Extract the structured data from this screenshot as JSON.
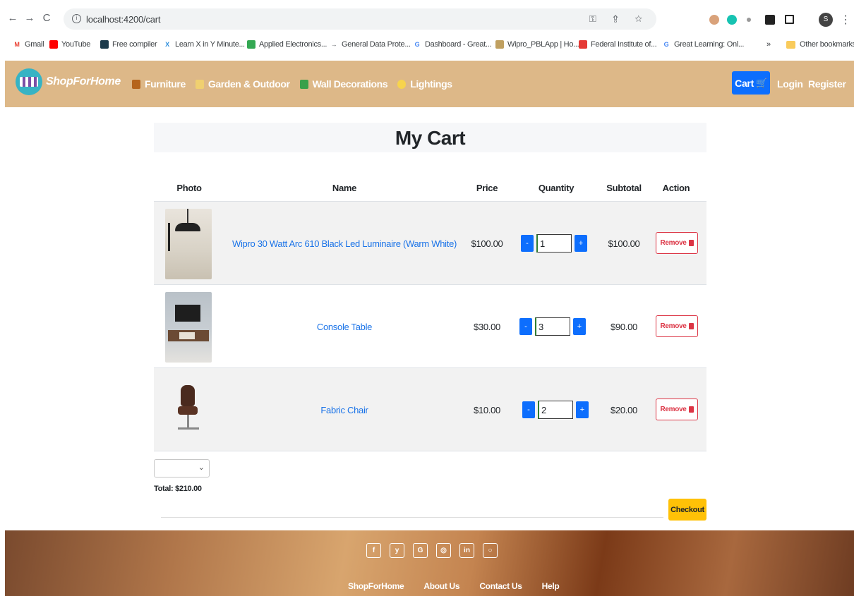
{
  "browser": {
    "url": "localhost:4200/cart",
    "bookmarks": [
      {
        "label": "Gmail",
        "icon": "gmail-icon",
        "color": "#ea4335"
      },
      {
        "label": "YouTube",
        "icon": "youtube-icon",
        "color": "#ff0000"
      },
      {
        "label": "Free compiler",
        "icon": "compiler-icon",
        "color": "#1b3a4b"
      },
      {
        "label": "Learn X in Y Minute...",
        "icon": "x-icon",
        "color": "#2f8fdd"
      },
      {
        "label": "Applied Electronics...",
        "icon": "drive-icon",
        "color": "#34a853"
      },
      {
        "label": "General Data Prote...",
        "icon": "arrow-icon",
        "color": "#5f6368"
      },
      {
        "label": "Dashboard - Great...",
        "icon": "g-icon",
        "color": "#4285f4"
      },
      {
        "label": "Wipro_PBLApp | Ho...",
        "icon": "wipro-icon",
        "color": "#c0a060"
      },
      {
        "label": "Federal Institute of...",
        "icon": "fi-icon",
        "color": "#e53935"
      },
      {
        "label": "Great Learning: Onl...",
        "icon": "g-icon",
        "color": "#4285f4"
      }
    ],
    "more": "»",
    "other_bookmarks": "Other bookmarks",
    "profile_initial": "S"
  },
  "navbar": {
    "brand": "ShopForHome",
    "menu": [
      {
        "label": "Furniture",
        "icon": "chair-icon",
        "color": "#b5651d"
      },
      {
        "label": "Garden & Outdoor",
        "icon": "flower-icon",
        "color": "#f0d070"
      },
      {
        "label": "Wall Decorations",
        "icon": "picture-icon",
        "color": "#3aa04a"
      },
      {
        "label": "Lightings",
        "icon": "bulb-icon",
        "color": "#f7d44c"
      }
    ],
    "cart_label": "Cart",
    "login": "Login",
    "register": "Register",
    "accent": "#0d6efd"
  },
  "cart": {
    "title": "My Cart",
    "headers": {
      "photo": "Photo",
      "name": "Name",
      "price": "Price",
      "quantity": "Quantity",
      "subtotal": "Subtotal",
      "action": "Action"
    },
    "items": [
      {
        "name": "Wipro 30 Watt Arc 610 Black Led Luminaire (Warm White)",
        "price": "$100.00",
        "quantity": "1",
        "subtotal": "$100.00",
        "remove": "Remove"
      },
      {
        "name": "Console Table",
        "price": "$30.00",
        "quantity": "3",
        "subtotal": "$90.00",
        "remove": "Remove"
      },
      {
        "name": "Fabric Chair",
        "price": "$10.00",
        "quantity": "2",
        "subtotal": "$20.00",
        "remove": "Remove"
      }
    ],
    "minus": "-",
    "plus": "+",
    "total": "Total: $210.00",
    "checkout": "Checkout"
  },
  "footer": {
    "social": [
      {
        "glyph": "f",
        "icon": "facebook-icon"
      },
      {
        "glyph": "y",
        "icon": "twitter-icon"
      },
      {
        "glyph": "G",
        "icon": "google-icon"
      },
      {
        "glyph": "◎",
        "icon": "instagram-icon"
      },
      {
        "glyph": "in",
        "icon": "linkedin-icon"
      },
      {
        "glyph": "○",
        "icon": "github-icon"
      }
    ],
    "links": [
      "ShopForHome",
      "About Us",
      "Contact Us",
      "Help"
    ]
  }
}
